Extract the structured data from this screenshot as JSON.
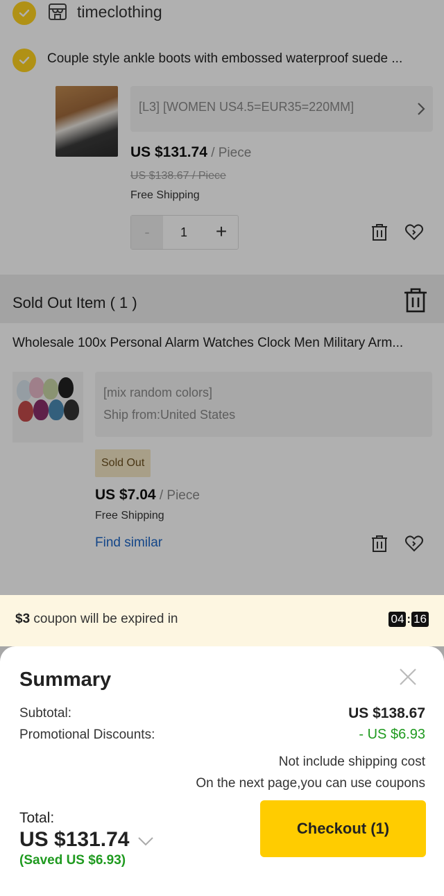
{
  "store": {
    "name": "timeclothing"
  },
  "item1": {
    "title": "Couple style ankle boots with embossed waterproof suede ...",
    "variant": "[L3] [WOMEN US4.5=EUR35=220MM]",
    "price": "US $131.74",
    "unit": " / Piece",
    "old_price": "US $138.67 / Piece",
    "shipping": "Free Shipping",
    "quantity": "1",
    "minus_label": "-",
    "plus_label": "+"
  },
  "soldout": {
    "header": "Sold Out Item ( 1 )",
    "title": "Wholesale 100x Personal Alarm Watches Clock Men Military Arm...",
    "variant_line1": "[mix random colors]",
    "variant_line2": "Ship from:United States",
    "badge": "Sold Out",
    "price": "US $7.04",
    "unit": " / Piece",
    "shipping": "Free Shipping",
    "find_similar": "Find similar"
  },
  "coupon": {
    "amount": "$3",
    "text": " coupon will be expired in",
    "timer_minutes": "04",
    "timer_seconds": "16",
    "timer_sep": ":"
  },
  "summary": {
    "title": "Summary",
    "subtotal_label": "Subtotal:",
    "subtotal_value": "US $138.67",
    "discount_label": "Promotional Discounts:",
    "discount_value": "- US $6.93",
    "note1": "Not include shipping cost",
    "note2": "On the next page,you can use coupons",
    "total_label": "Total:",
    "total_value": "US $131.74",
    "saved": "(Saved US $6.93)",
    "checkout_label": "Checkout (1)"
  },
  "colors": {
    "accent_yellow": "#ffcc00",
    "check_yellow": "#ffd21f",
    "discount_green": "#1f9a1f",
    "link_blue": "#1d66c6",
    "coupon_bg": "#fdf6e1"
  }
}
